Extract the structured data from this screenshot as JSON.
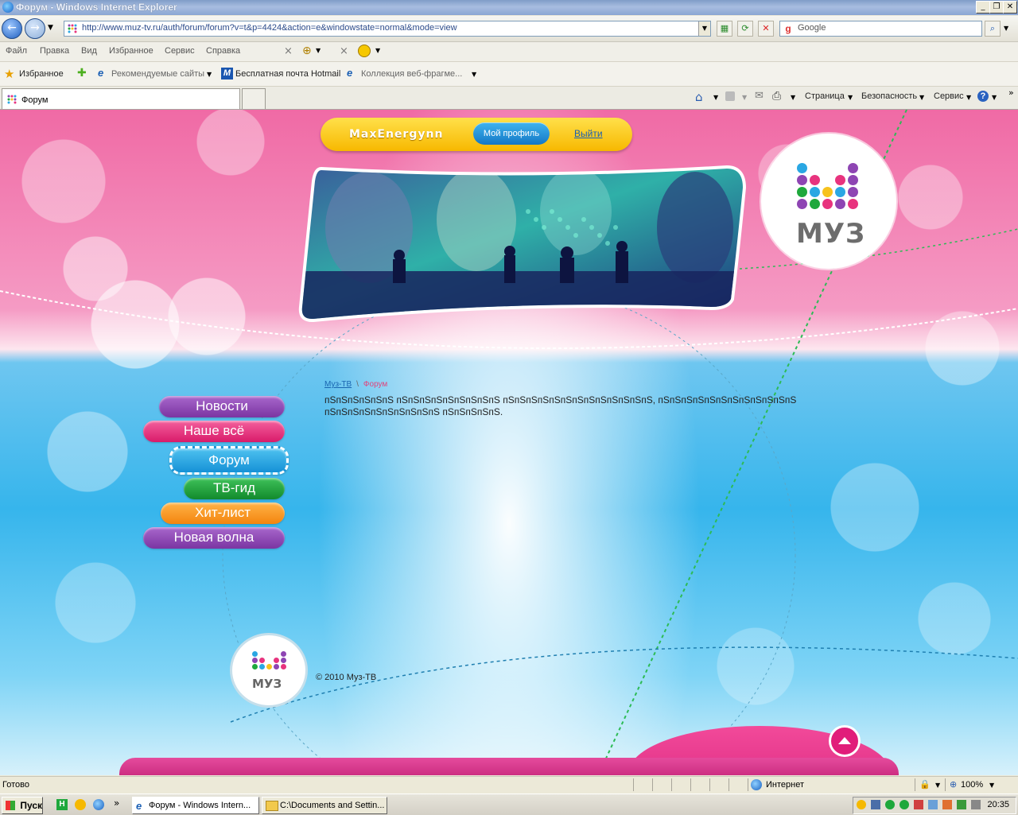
{
  "window": {
    "title": "Форум - Windows Internet Explorer"
  },
  "address": {
    "url": "http://www.muz-tv.ru/auth/forum/forum?v=t&p=4424&action=e&windowstate=normal&mode=view",
    "search_placeholder": "Google"
  },
  "menu": [
    "Файл",
    "Правка",
    "Вид",
    "Избранное",
    "Сервис",
    "Справка"
  ],
  "favorites": {
    "label": "Избранное",
    "items": [
      "Рекомендуемые сайты",
      "Бесплатная почта Hotmail",
      "Коллекция веб-фрагме..."
    ]
  },
  "tabs": [
    {
      "label": "Форум"
    }
  ],
  "commandbar": [
    "Страница",
    "Безопасность",
    "Сервис"
  ],
  "site": {
    "user": {
      "name": "MaxEnergynn",
      "profile_label": "Мой профиль",
      "logout_label": "Выйти"
    },
    "logo_text": "МУЗ",
    "nav": [
      {
        "label": "Новости",
        "color": "#8e45b3"
      },
      {
        "label": "Наше всё",
        "color": "#e8337e"
      },
      {
        "label": "Форум",
        "color": "#2aa7e3",
        "active": true
      },
      {
        "label": "ТВ-гид",
        "color": "#1ea83c"
      },
      {
        "label": "Хит-лист",
        "color": "#f7941d"
      },
      {
        "label": "Новая волна",
        "color": "#8e45b3"
      }
    ],
    "breadcrumb": {
      "home": "Муз-ТВ",
      "separator": "\\",
      "current": "Форум"
    },
    "content_text": "пЅпЅпЅпЅпЅпЅ пЅпЅпЅпЅпЅпЅпЅпЅпЅ пЅпЅпЅпЅпЅпЅпЅпЅпЅпЅпЅпЅпЅ, пЅпЅпЅпЅпЅпЅпЅпЅпЅпЅпЅпЅ пЅпЅпЅпЅпЅпЅпЅпЅпЅпЅ пЅпЅпЅпЅпЅ.",
    "copyright": "© 2010 Муз-ТВ"
  },
  "status": {
    "text": "Готово",
    "zone": "Интернет",
    "zoom": "100%"
  },
  "taskbar": {
    "start": "Пуск",
    "tasks": [
      "Форум - Windows Intern...",
      "C:\\Documents and Settin..."
    ],
    "clock": "20:35"
  }
}
